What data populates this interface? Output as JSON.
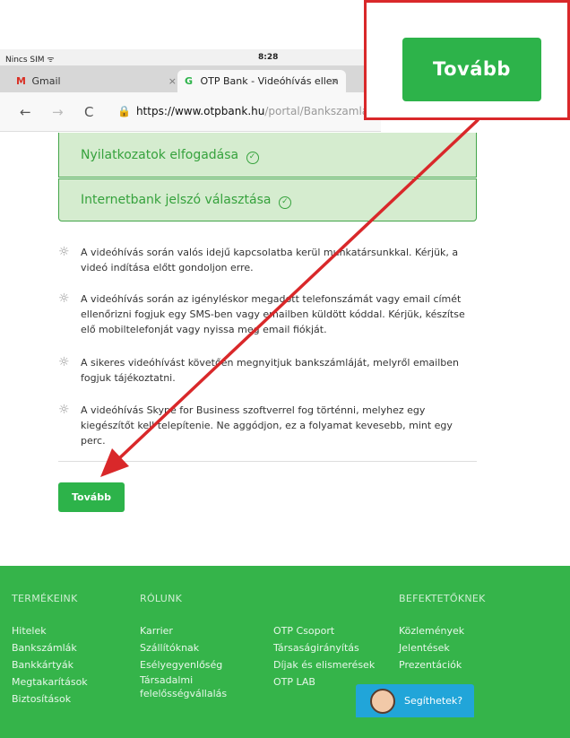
{
  "status_bar": {
    "carrier": "Nincs SIM ᯤ",
    "time": "8:28"
  },
  "tabs": [
    {
      "icon": "M",
      "label": "Gmail",
      "close": "×"
    },
    {
      "icon": "G",
      "label": "OTP Bank - Videóhívás ellen",
      "close": "×"
    }
  ],
  "address_bar": {
    "back": "←",
    "forward": "→",
    "reload": "C",
    "url_host": "https://www.otpbank.hu",
    "url_path": "/portal/Bankszamla/Vi"
  },
  "steps": [
    {
      "label": "Nyilatkozatok elfogadása",
      "check": "✓"
    },
    {
      "label": "Internetbank jelszó választása",
      "check": "✓"
    }
  ],
  "tips": [
    "A videóhívás során valós idejű kapcsolatba kerül munkatársunkkal. Kérjük, a videó indítása előtt gondoljon erre.",
    "A videóhívás során az igényléskor megadott telefonszámát vagy email címét ellenőrizni fogjuk egy SMS-ben vagy emailben küldött kóddal. Kérjük, készítse elő mobiltelefonját vagy nyissa meg email fiókját.",
    "A sikeres videóhívást követően megnyitjuk bankszámláját, melyről emailben fogjuk tájékoztatni.",
    "A videóhívás Skype for Business szoftverrel fog történni, melyhez egy kiegészítőt kell telepítenie. Ne aggódjon, ez a folyamat kevesebb, mint egy perc."
  ],
  "tip_icon": "-ᷢ-",
  "continue_label": "Tovább",
  "callout_label": "Tovább",
  "footer": {
    "col1": {
      "head": "TERMÉKEINK",
      "items": [
        "Hitelek",
        "Bankszámlák",
        "Bankkártyák",
        "Megtakarítások",
        "Biztosítások"
      ]
    },
    "col2": {
      "head": "RÓLUNK",
      "items": [
        "Karrier",
        "Szállítóknak",
        "Esélyegyenlőség",
        "Társadalmi",
        "felelősségvállalás"
      ]
    },
    "col3": {
      "head": "",
      "items": [
        "OTP Csoport",
        "Társaságirányítás",
        "Díjak és elismerések",
        "OTP LAB"
      ]
    },
    "col4": {
      "head": "BEFEKTETŐKNEK",
      "items": [
        "Közlemények",
        "Jelentések",
        "Prezentációk"
      ]
    },
    "help_label": "Segíthetek?"
  },
  "colors": {
    "brand_green": "#2db34a",
    "footer_green": "#35b44a",
    "annotation_red": "#d9282a",
    "help_blue": "#21a5d9"
  }
}
